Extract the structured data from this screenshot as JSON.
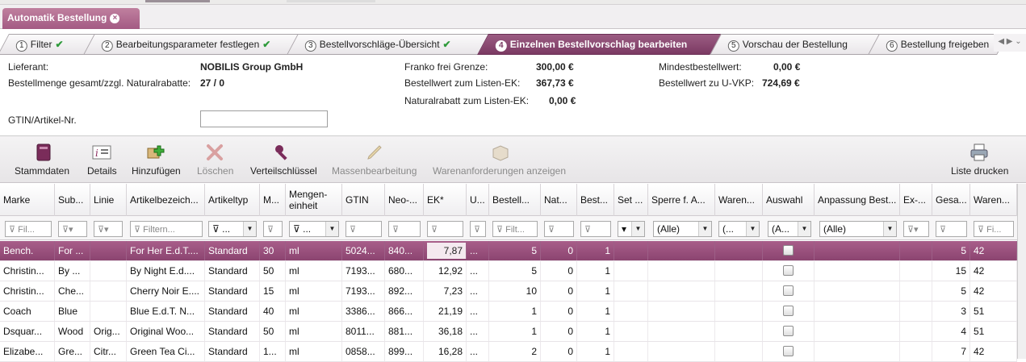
{
  "doc_tab": {
    "title": "Automatik Bestellung",
    "close": "×"
  },
  "wizard": {
    "steps": [
      {
        "num": "1",
        "label": "Filter",
        "done": "✔"
      },
      {
        "num": "2",
        "label": "Bearbeitungsparameter festlegen",
        "done": "✔"
      },
      {
        "num": "3",
        "label": "Bestellvorschläge-Übersicht",
        "done": "✔"
      },
      {
        "num": "4",
        "label": "Einzelnen Bestellvorschlag bearbeiten",
        "done": ""
      },
      {
        "num": "5",
        "label": "Vorschau der Bestellung",
        "done": ""
      },
      {
        "num": "6",
        "label": "Bestellung freigeben",
        "done": ""
      }
    ],
    "nav": "◀ ▶ ⌄"
  },
  "info": {
    "lieferant_label": "Lieferant:",
    "lieferant_value": "NOBILIS Group GmbH",
    "menge_label": "Bestellmenge gesamt/zzgl. Naturalrabatte:",
    "menge_value": "27 / 0",
    "franko_label": "Franko frei Grenze:",
    "franko_value": "300,00 €",
    "listen_label": "Bestellwert zum Listen-EK:",
    "listen_value": "367,73 €",
    "natural_label": "Naturalrabatt zum Listen-EK:",
    "natural_value": "0,00 €",
    "mindest_label": "Mindestbestellwert:",
    "mindest_value": "0,00 €",
    "uvkp_label": "Bestellwert zu U-VKP:",
    "uvkp_value": "724,69 €",
    "gtin_label": "GTIN/Artikel-Nr.",
    "gtin_value": ""
  },
  "toolbar": {
    "stammdaten": "Stammdaten",
    "details": "Details",
    "hinzufuegen": "Hinzufügen",
    "loeschen": "Löschen",
    "verteil": "Verteilschlüssel",
    "massen": "Massenbearbeitung",
    "waren": "Warenanforderungen anzeigen",
    "drucken": "Liste drucken"
  },
  "columns": [
    "Marke",
    "Sub...",
    "Linie",
    "Artikelbezeich...",
    "Artikeltyp",
    "M...",
    "Mengen-\neinheit",
    "GTIN",
    "Neo-...",
    "EK*",
    "U...",
    "Bestell...",
    "Nat...",
    "Best...",
    "Set ...",
    "Sperre f. A...",
    "Waren...",
    "Auswahl",
    "Anpassung Best...",
    "Ex-...",
    "Gesa...",
    "Waren..."
  ],
  "filters": {
    "fil": "Fil...",
    "filtern": "Filtern...",
    "filt": "Filt...",
    "fi": "Fi...",
    "alle": "(Alle)",
    "a_dots": "(A...",
    "paren_dots": "(...",
    "dots": "..."
  },
  "rows": [
    {
      "marke": "Bench.",
      "sub": "For ...",
      "linie": "",
      "artikel": "For Her E.d.T....",
      "typ": "Standard",
      "m": "30",
      "einheit": "ml",
      "gtin": "5024...",
      "neo": "840...",
      "ek": "7,87",
      "u": "...",
      "bestell": "5",
      "nat": "0",
      "best": "1",
      "gesa": "5",
      "waren": "42",
      "selected": true
    },
    {
      "marke": "Christin...",
      "sub": "By ...",
      "linie": "",
      "artikel": "By Night E.d....",
      "typ": "Standard",
      "m": "50",
      "einheit": "ml",
      "gtin": "7193...",
      "neo": "680...",
      "ek": "12,92",
      "u": "...",
      "bestell": "5",
      "nat": "0",
      "best": "1",
      "gesa": "15",
      "waren": "42",
      "selected": false
    },
    {
      "marke": "Christin...",
      "sub": "Che...",
      "linie": "",
      "artikel": "Cherry Noir E....",
      "typ": "Standard",
      "m": "15",
      "einheit": "ml",
      "gtin": "7193...",
      "neo": "892...",
      "ek": "7,23",
      "u": "...",
      "bestell": "10",
      "nat": "0",
      "best": "1",
      "gesa": "5",
      "waren": "42",
      "selected": false
    },
    {
      "marke": "Coach",
      "sub": "Blue",
      "linie": "",
      "artikel": "Blue E.d.T. N...",
      "typ": "Standard",
      "m": "40",
      "einheit": "ml",
      "gtin": "3386...",
      "neo": "866...",
      "ek": "21,19",
      "u": "...",
      "bestell": "1",
      "nat": "0",
      "best": "1",
      "gesa": "3",
      "waren": "51",
      "selected": false
    },
    {
      "marke": "Dsquar...",
      "sub": "Wood",
      "linie": "Orig...",
      "artikel": "Original Woo...",
      "typ": "Standard",
      "m": "50",
      "einheit": "ml",
      "gtin": "8011...",
      "neo": "881...",
      "ek": "36,18",
      "u": "...",
      "bestell": "1",
      "nat": "0",
      "best": "1",
      "gesa": "4",
      "waren": "51",
      "selected": false
    },
    {
      "marke": "Elizabe...",
      "sub": "Gre...",
      "linie": "Citr...",
      "artikel": "Green Tea Ci...",
      "typ": "Standard",
      "m": "1...",
      "einheit": "ml",
      "gtin": "0858...",
      "neo": "899...",
      "ek": "16,28",
      "u": "...",
      "bestell": "2",
      "nat": "0",
      "best": "1",
      "gesa": "7",
      "waren": "42",
      "selected": false
    }
  ]
}
